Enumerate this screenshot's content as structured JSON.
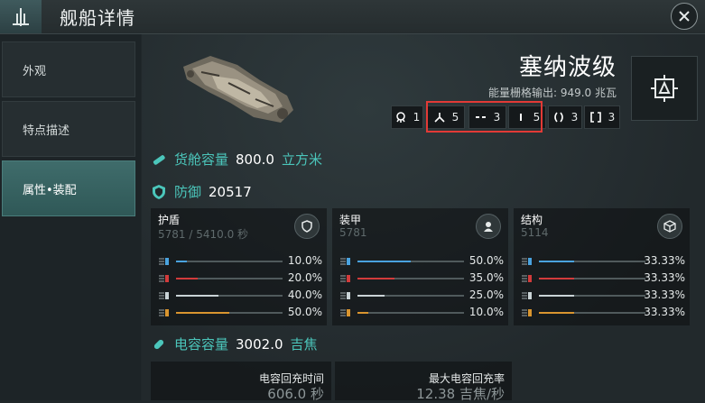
{
  "header": {
    "title": "舰船详情",
    "logo_icon": "fleet-emblem-icon",
    "close_icon": "close-icon"
  },
  "sidebar": {
    "items": [
      {
        "label": "外观",
        "active": false
      },
      {
        "label": "特点描述",
        "active": false
      },
      {
        "label": "属性•装配",
        "active": true
      }
    ]
  },
  "ship": {
    "name": "塞纳波级",
    "power_label": "能量栅格输出:",
    "power_value": "949.0 兆瓦",
    "slots": [
      {
        "icon": "drone-bay-icon",
        "count": "1"
      },
      {
        "icon": "high-slot-icon",
        "count": "5"
      },
      {
        "icon": "mid-slot-icon",
        "count": "3"
      },
      {
        "icon": "low-slot-icon",
        "count": "5"
      },
      {
        "icon": "rig-slot-icon",
        "count": "3"
      },
      {
        "icon": "subsystem-slot-icon",
        "count": "3"
      }
    ]
  },
  "cargo": {
    "label": "货舱容量",
    "value": "800.0",
    "unit": "立方米"
  },
  "defense": {
    "label": "防御",
    "value": "20517",
    "columns": [
      {
        "title": "护盾",
        "sub": "5781 / 5410.0 秒",
        "icon": "shield-icon",
        "resists": [
          {
            "type": "em",
            "pct": "10.0%",
            "fill": 0.1
          },
          {
            "type": "thermal",
            "pct": "20.0%",
            "fill": 0.2
          },
          {
            "type": "kinetic",
            "pct": "40.0%",
            "fill": 0.4
          },
          {
            "type": "explosive",
            "pct": "50.0%",
            "fill": 0.5
          }
        ]
      },
      {
        "title": "装甲",
        "sub": "5781",
        "icon": "armor-icon",
        "resists": [
          {
            "type": "em",
            "pct": "50.0%",
            "fill": 0.5
          },
          {
            "type": "thermal",
            "pct": "35.0%",
            "fill": 0.35
          },
          {
            "type": "kinetic",
            "pct": "25.0%",
            "fill": 0.25
          },
          {
            "type": "explosive",
            "pct": "10.0%",
            "fill": 0.1
          }
        ]
      },
      {
        "title": "结构",
        "sub": "5114",
        "icon": "structure-icon",
        "resists": [
          {
            "type": "em",
            "pct": "33.33%",
            "fill": 0.3333
          },
          {
            "type": "thermal",
            "pct": "33.33%",
            "fill": 0.3333
          },
          {
            "type": "kinetic",
            "pct": "33.33%",
            "fill": 0.3333
          },
          {
            "type": "explosive",
            "pct": "33.33%",
            "fill": 0.3333
          }
        ]
      }
    ]
  },
  "capacitor": {
    "label": "电容容量",
    "value": "3002.0",
    "unit": "吉焦",
    "recharge_time_label": "电容回充时间",
    "recharge_time_value": "606.0 秒",
    "max_rate_label": "最大电容回充率",
    "max_rate_value": "12.38 吉焦/秒"
  },
  "colors": {
    "accent": "#4bc6bb",
    "em": "#4aa3df",
    "thermal": "#d23b3b",
    "kinetic": "#c9d3d6",
    "explosive": "#d9952f",
    "highlight": "#e23a36",
    "active_tab": "#3f6c6b"
  }
}
